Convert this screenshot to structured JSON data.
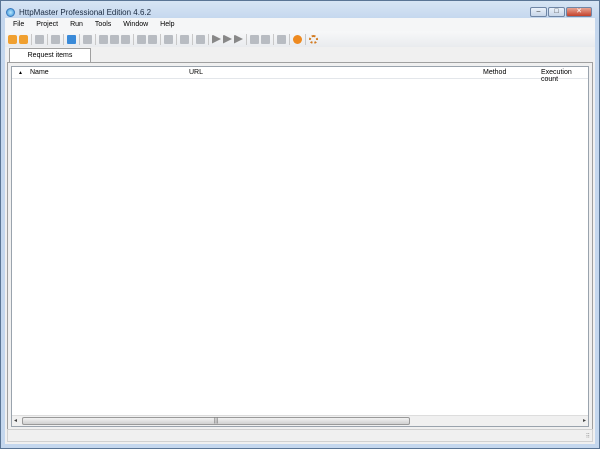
{
  "window": {
    "title": "HttpMaster Professional Edition 4.6.2",
    "minimize": "–",
    "maximize": "□",
    "close": "✕"
  },
  "menu": [
    "File",
    "Project",
    "Run",
    "Tools",
    "Window",
    "Help"
  ],
  "toolbar": [
    {
      "icon": "new-project-icon",
      "style": "orange"
    },
    {
      "icon": "open-project-icon",
      "style": "orange"
    },
    "sep",
    {
      "icon": "save-icon",
      "style": ""
    },
    "sep",
    {
      "icon": "save-as-icon",
      "style": ""
    },
    "sep",
    {
      "icon": "add-request-icon",
      "style": "blue"
    },
    "sep",
    {
      "icon": "clone-icon",
      "style": ""
    },
    "sep",
    {
      "icon": "add-item-icon",
      "style": ""
    },
    {
      "icon": "edit-item-icon",
      "style": ""
    },
    {
      "icon": "delete-item-icon",
      "style": ""
    },
    "sep",
    {
      "icon": "import-icon",
      "style": ""
    },
    {
      "icon": "export-icon",
      "style": ""
    },
    "sep",
    {
      "icon": "group-icon",
      "style": ""
    },
    "sep",
    {
      "icon": "run-selected-icon",
      "style": ""
    },
    "sep",
    {
      "icon": "parameters-icon",
      "style": ""
    },
    "sep",
    {
      "icon": "execute-icon",
      "style": "dark"
    },
    {
      "icon": "execute-all-icon",
      "style": "dark"
    },
    {
      "icon": "execute-filter-icon",
      "style": "dark"
    },
    "sep",
    {
      "icon": "results-icon",
      "style": ""
    },
    {
      "icon": "validation-icon",
      "style": ""
    },
    "sep",
    {
      "icon": "lock-icon",
      "style": ""
    },
    "sep",
    {
      "icon": "play-circle-icon",
      "style": "play"
    },
    "sep",
    {
      "icon": "settings-gear-icon",
      "style": "gear"
    }
  ],
  "tabs": [
    {
      "label": "Request items",
      "active": true
    }
  ],
  "table": {
    "columns": [
      "Name",
      "URL",
      "Method",
      "Execution count"
    ],
    "sort_indicator": "▲",
    "rows": []
  },
  "scrollbar": {
    "left": "◂",
    "right": "▸",
    "grip": "|||"
  },
  "status": {
    "grip": "⠿"
  }
}
